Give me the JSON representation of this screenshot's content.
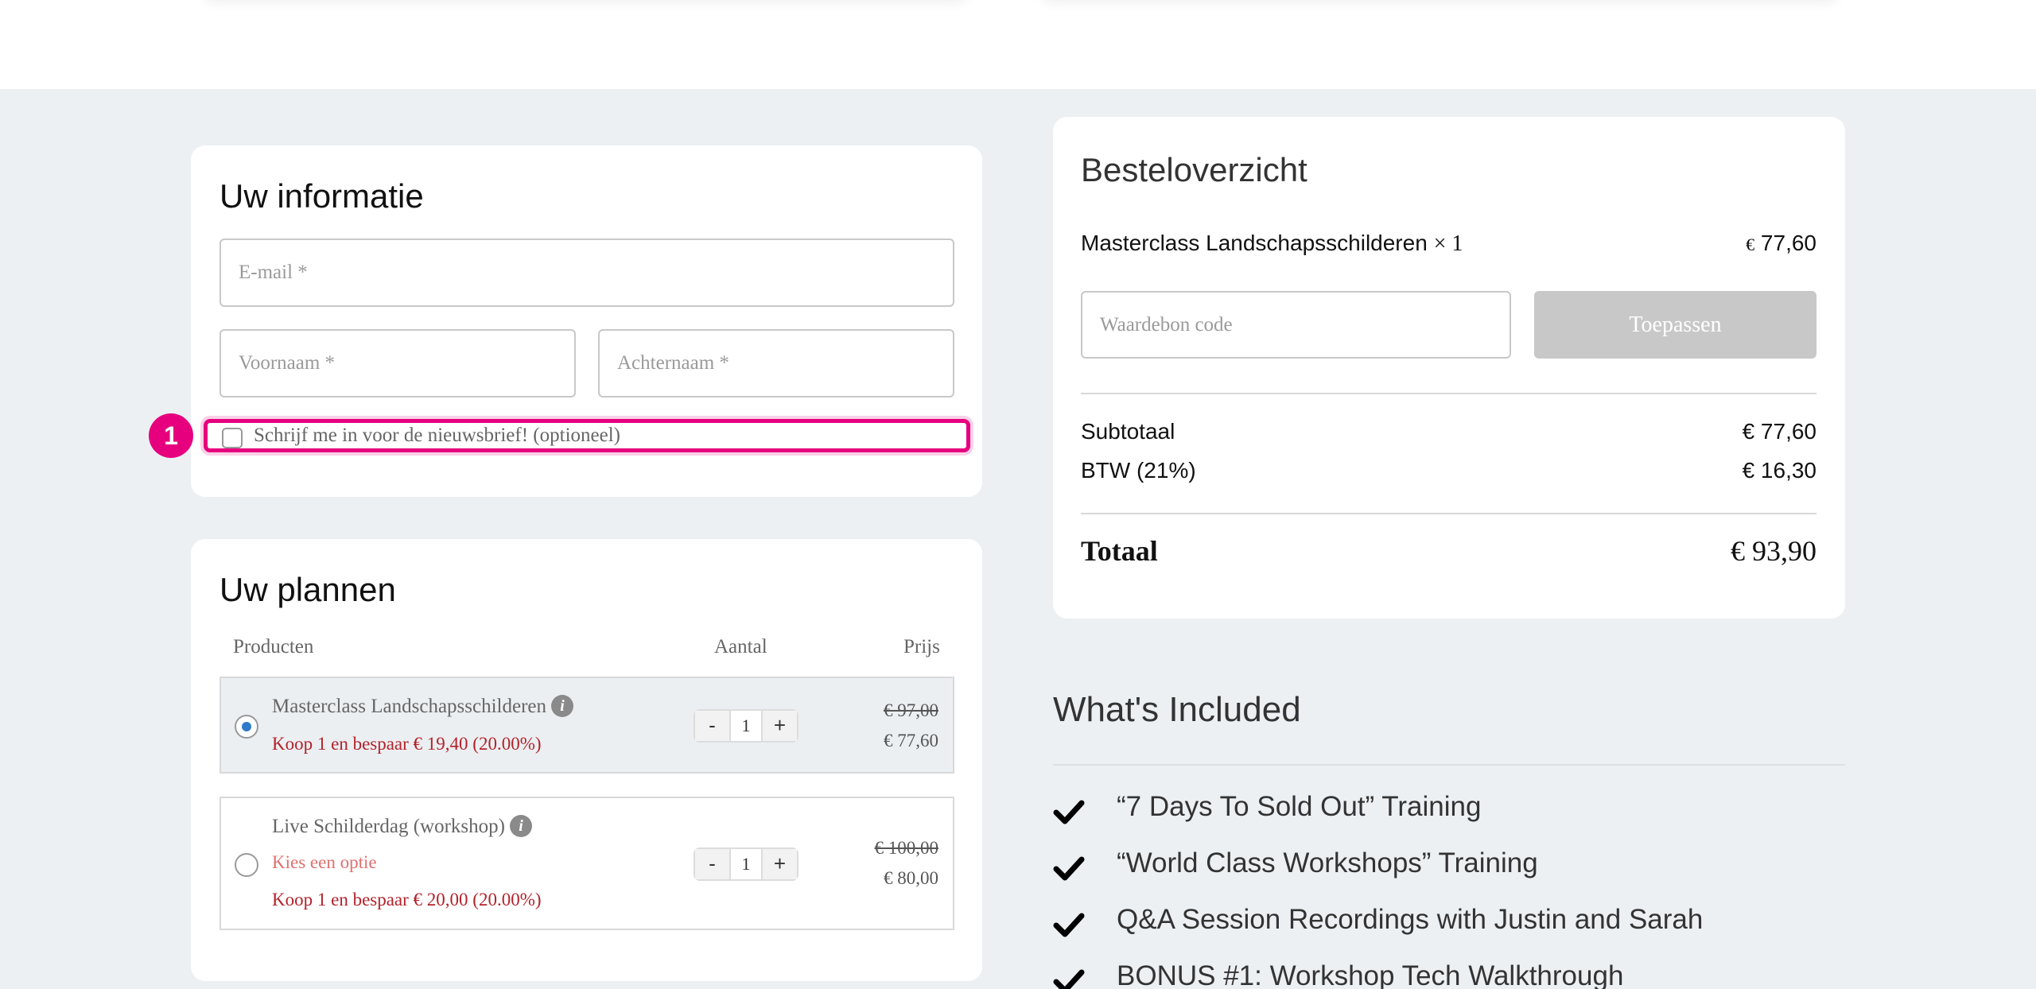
{
  "info": {
    "title": "Uw informatie",
    "email_placeholder": "E-mail *",
    "firstname_placeholder": "Voornaam *",
    "lastname_placeholder": "Achternaam *",
    "newsletter_label": "Schrijf me in voor de nieuwsbrief! (optioneel)",
    "newsletter_checked": false,
    "annotation_number": "1"
  },
  "plans": {
    "title": "Uw plannen",
    "columns": {
      "products": "Producten",
      "quantity": "Aantal",
      "price": "Prijs"
    },
    "items": [
      {
        "name": "Masterclass Landschapsschilderen",
        "info_icon": "info-icon",
        "selected": true,
        "save_text": "Koop 1 en bespaar € 19,40 (20.00%)",
        "quantity": "1",
        "old_price": "€ 97,00",
        "new_price": "€ 77,60"
      },
      {
        "name": "Live Schilderdag (workshop)",
        "info_icon": "info-icon",
        "selected": false,
        "option_text": "Kies een optie",
        "save_text": "Koop 1 en bespaar € 20,00 (20.00%)",
        "quantity": "1",
        "old_price": "€ 100,00",
        "new_price": "€ 80,00"
      }
    ],
    "stepper": {
      "minus": "-",
      "plus": "+"
    }
  },
  "order": {
    "title": "Besteloverzicht",
    "line_item": "Masterclass Landschapsschilderen",
    "line_qty": "× 1",
    "line_currency": "€",
    "line_price": "77,60",
    "coupon_placeholder": "Waardebon code",
    "apply_label": "Toepassen",
    "subtotal_label": "Subtotaal",
    "subtotal_value": "€ 77,60",
    "vat_label": "BTW (21%)",
    "vat_value": "€ 16,30",
    "total_label": "Totaal",
    "total_value": "€ 93,90"
  },
  "included": {
    "title": "What's Included",
    "items": [
      "“7 Days To Sold Out” Training",
      "“World Class Workshops” Training",
      "Q&A Session Recordings with Justin and Sarah",
      "BONUS #1: Workshop Tech Walkthrough"
    ]
  },
  "colors": {
    "page_gray": "#edf0f3",
    "highlight_pink": "#e6007e",
    "discount_red": "#b3222a",
    "option_red": "#e0706f",
    "radio_blue": "#2f7ac9",
    "button_disabled_gray": "#c8c8c8"
  }
}
